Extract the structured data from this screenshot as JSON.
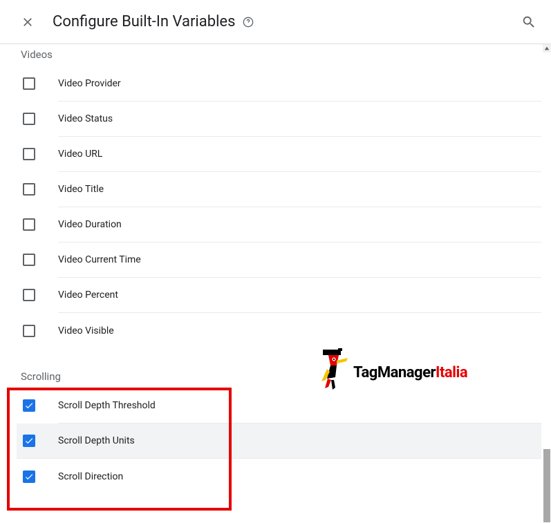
{
  "header": {
    "title": "Configure Built-In Variables"
  },
  "sections": {
    "videos": {
      "title": "Videos",
      "items": [
        {
          "label": "Video Provider",
          "checked": false
        },
        {
          "label": "Video Status",
          "checked": false
        },
        {
          "label": "Video URL",
          "checked": false
        },
        {
          "label": "Video Title",
          "checked": false
        },
        {
          "label": "Video Duration",
          "checked": false
        },
        {
          "label": "Video Current Time",
          "checked": false
        },
        {
          "label": "Video Percent",
          "checked": false
        },
        {
          "label": "Video Visible",
          "checked": false
        }
      ]
    },
    "scrolling": {
      "title": "Scrolling",
      "items": [
        {
          "label": "Scroll Depth Threshold",
          "checked": true
        },
        {
          "label": "Scroll Depth Units",
          "checked": true
        },
        {
          "label": "Scroll Direction",
          "checked": true
        }
      ]
    }
  },
  "logo": {
    "text1": "TagManager",
    "text2": "Italia"
  }
}
